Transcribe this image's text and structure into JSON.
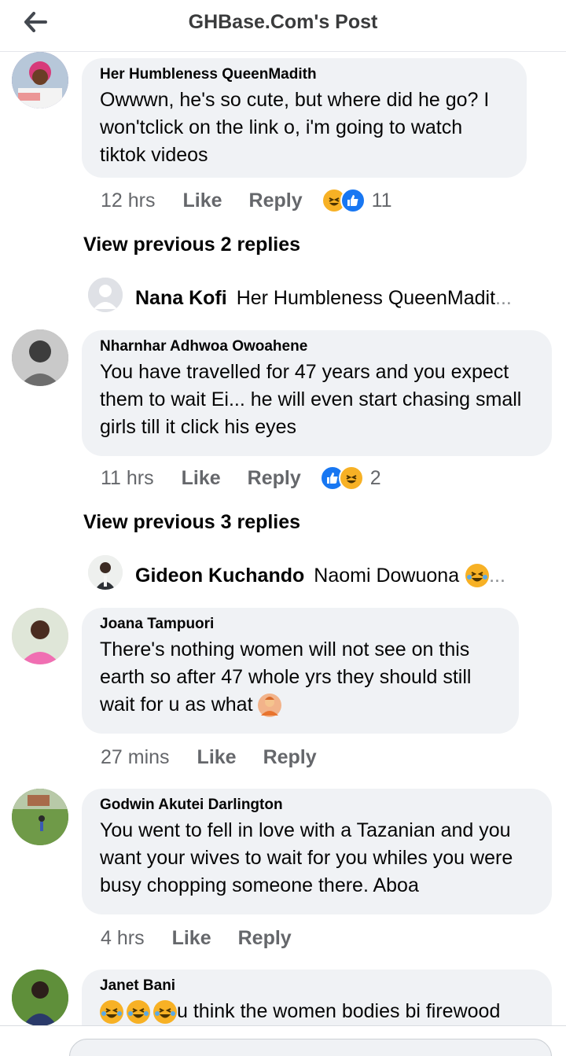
{
  "header": {
    "title": "GHBase.Com's Post"
  },
  "comments": [
    {
      "author": "Her Humbleness QueenMadith",
      "text": "Owwwn, he's so cute, but where did he go? I won'tclick on the link o, i'm going to watch tiktok videos",
      "time": "12 hrs",
      "like": "Like",
      "reply": "Reply",
      "reaction_count": "11"
    },
    {
      "author": "Nharnhar Adhwoa Owoahene",
      "text": "You have travelled for 47 years and you expect them to wait Ei... he will even start chasing small girls till it click his eyes",
      "time": "11 hrs",
      "like": "Like",
      "reply": "Reply",
      "reaction_count": "2"
    },
    {
      "author": "Joana Tampuori",
      "text": "There's nothing women will not see on this earth so after 47 whole yrs they should still wait for u as what",
      "time": "27 mins",
      "like": "Like",
      "reply": "Reply"
    },
    {
      "author": "Godwin Akutei Darlington",
      "text": "You went to fell in love with a Tazanian and you want your wives to wait for you whiles you were busy chopping someone there. Aboa",
      "time": "4 hrs",
      "like": "Like",
      "reply": "Reply"
    },
    {
      "author": "Janet Bani",
      "text": "u think the women bodies bi firewood"
    }
  ],
  "replies": [
    {
      "view_previous": "View previous 2 replies",
      "name": "Nana Kofi",
      "text": "Her Humbleness QueenMadit",
      "ellipsis": "..."
    },
    {
      "view_previous": "View previous 3 replies",
      "name": "Gideon Kuchando",
      "text": "Naomi Dowuona",
      "ellipsis": "..."
    }
  ],
  "icons": {
    "back": "back-arrow-icon",
    "like": "like-reaction-icon",
    "haha": "haha-reaction-icon",
    "emoji": "tears-of-joy-emoji",
    "shrug": "shrug-emoji"
  },
  "colors": {
    "like_blue": "#1877f2",
    "haha_yellow": "#f7b125",
    "bubble_bg": "#f0f2f5",
    "meta_gray": "#65676b"
  }
}
